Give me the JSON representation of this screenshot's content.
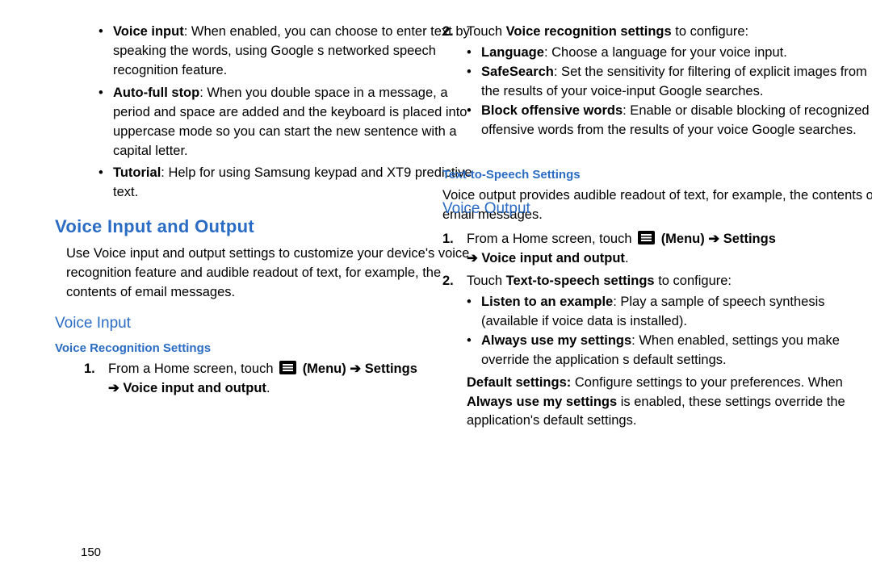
{
  "page_number": "150",
  "left": {
    "bullets": [
      {
        "b": "Voice input",
        "t": ": When enabled, you can choose to enter text by speaking the words, using Google s networked speech recognition feature."
      },
      {
        "b": "Auto-full stop",
        "t": ": When you double space in a message, a period and space are added and the keyboard is placed into uppercase mode so you can start the new sentence with a capital letter."
      },
      {
        "b": "Tutorial",
        "t": ": Help for using Samsung keypad and XT9 predictive text."
      }
    ],
    "h1": "Voice Input and Output",
    "intro": "Use Voice input and output settings to customize your device's voice recognition feature and audible readout of text, for example, the contents of email messages.",
    "h2": "Voice Input",
    "h3": "Voice Recognition Settings",
    "step1_a": "From a Home screen, touch",
    "step1_menu": "(Menu)",
    "step1_arrow": "➔",
    "step1_settings": "Settings",
    "step1_cont": "Voice input and output"
  },
  "right": {
    "step2_num": "2.",
    "step2_a": "Touch ",
    "step2_b": "Voice recognition settings",
    "step2_c": " to configure:",
    "r_bullets": [
      {
        "b": "Language",
        "t": ": Choose a language for your voice input."
      },
      {
        "b": "SafeSearch",
        "t": ": Set the sensitivity for filtering of explicit images from the results of your voice-input Google searches."
      },
      {
        "b": "Block offensive words",
        "t": ": Enable or disable blocking of recognized offensive words from the results of your voice Google searches."
      }
    ],
    "h2": "Voice Output",
    "h3": "Text-to-Speech Settings",
    "intro": "Voice output provides audible readout of text, for example, the contents of email messages.",
    "step1_num": "1.",
    "step1_a": "From a Home screen, touch",
    "step1_menu": "(Menu)",
    "step1_arrow": "➔",
    "step1_settings": "Settings",
    "step1_cont": "Voice input and output",
    "stepB_num": "2.",
    "stepB_a": "Touch ",
    "stepB_b": "Text-to-speech settings",
    "stepB_c": " to configure:",
    "s_bullets": [
      {
        "b": "Listen to an example",
        "t": ": Play a sample of speech synthesis (available if voice data is installed)."
      },
      {
        "b": "Always use my settings",
        "t": ": When enabled, settings you make override the application s default settings."
      }
    ],
    "default_b": "Default settings:",
    "default_t1": " Configure settings to your preferences. When ",
    "default_b2": "Always use my settings",
    "default_t2": " is enabled, these settings override the application's default settings."
  }
}
